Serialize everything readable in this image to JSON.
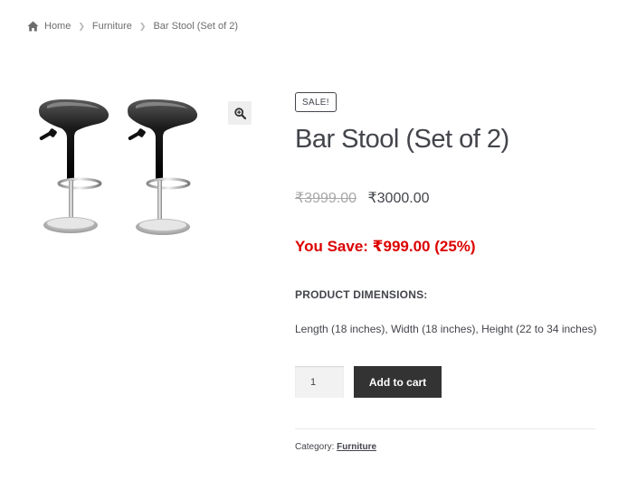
{
  "breadcrumb": {
    "items": [
      "Home",
      "Furniture",
      "Bar Stool (Set of 2)"
    ]
  },
  "product": {
    "sale_badge": "SALE!",
    "title": "Bar Stool (Set of 2)",
    "price_regular": "₹3999.00",
    "price_sale": "₹3000.00",
    "savings": "You Save: ₹999.00 (25%)",
    "dimensions_heading": "PRODUCT DIMENSIONS:",
    "dimensions_text": "Length (18 inches), Width (18 inches), Height (22 to 34 inches)",
    "quantity": "1",
    "add_to_cart_label": "Add to cart",
    "category_label": "Category:",
    "category_value": "Furniture"
  },
  "icons": {
    "home": "home-icon",
    "zoom": "zoom-icon",
    "separator": "chevron-right-icon"
  },
  "colors": {
    "savings_red": "#dd0000",
    "button_dark": "#333333",
    "text": "#43454b",
    "strike_grey": "#a8a8a8"
  }
}
